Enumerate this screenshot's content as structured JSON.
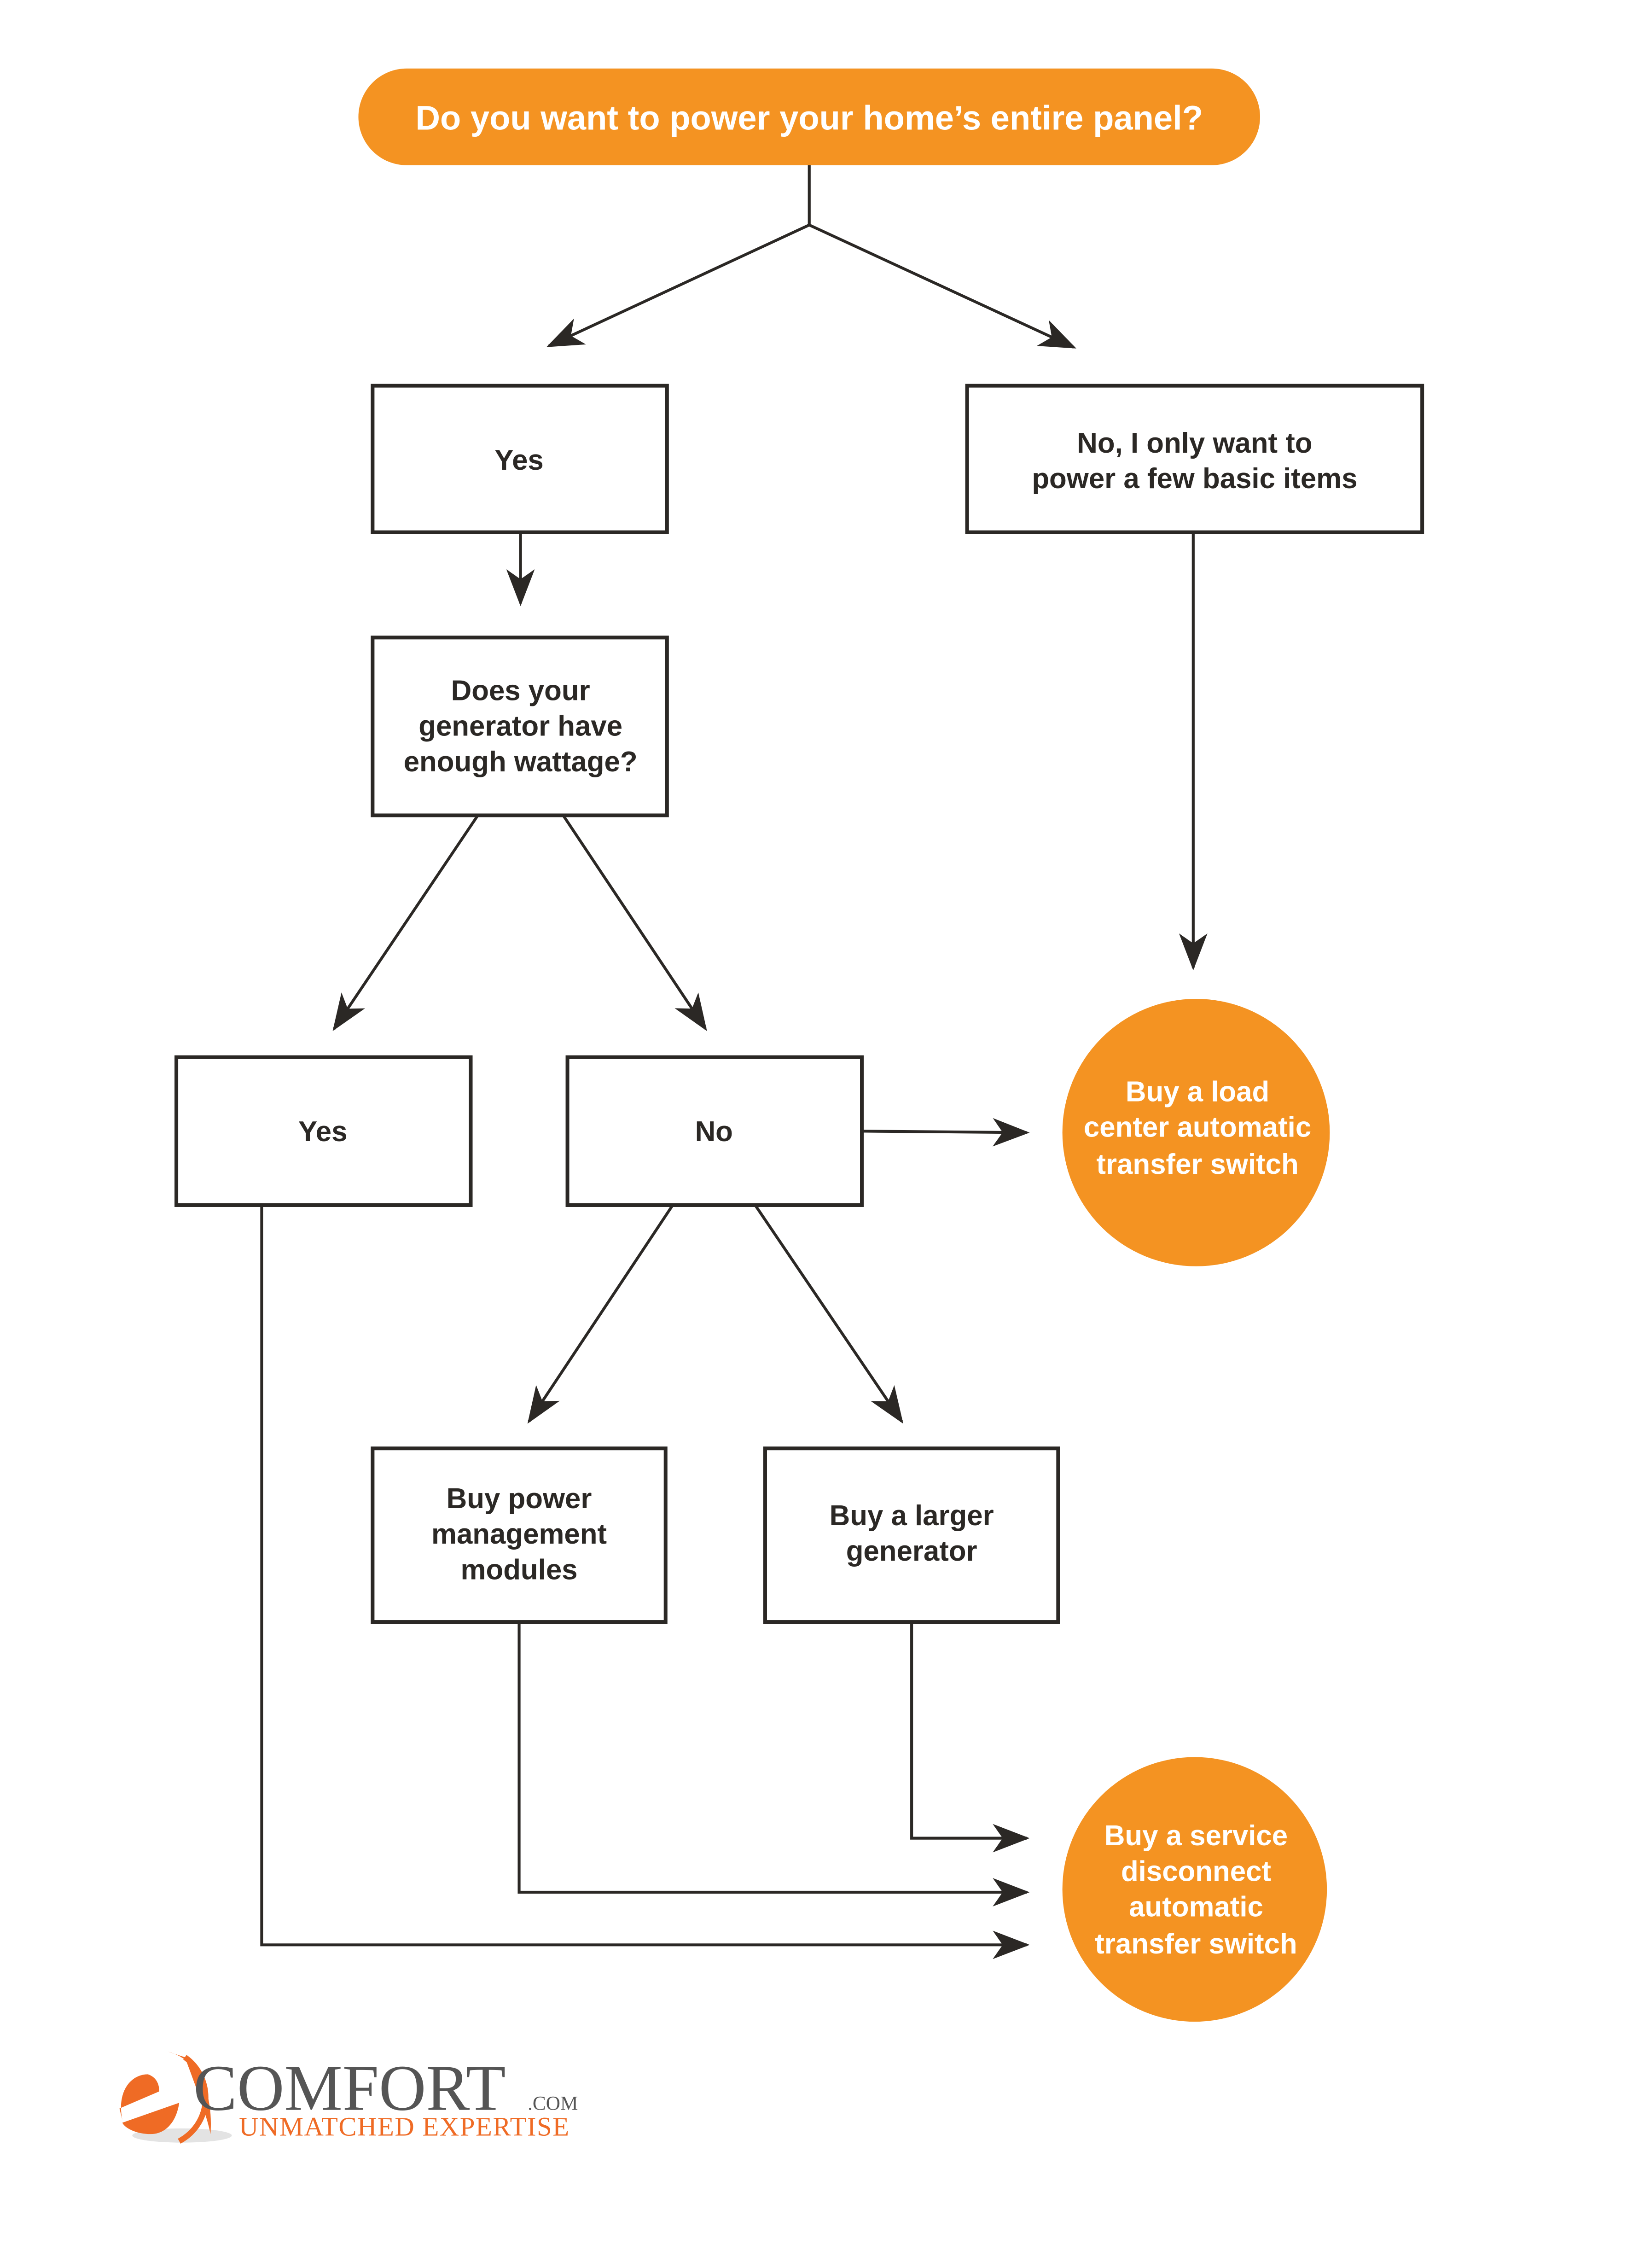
{
  "colors": {
    "accent": "#f49322",
    "stroke": "#2b2825",
    "logo_orange": "#ef6b25",
    "logo_gray": "#555555"
  },
  "title": {
    "text": "Do you want to power your home’s entire panel?"
  },
  "nodes": {
    "yes_panel": {
      "lines": [
        "Yes"
      ]
    },
    "no_basic": {
      "lines": [
        "No, I only want to",
        "power a few basic items"
      ]
    },
    "wattage_question": {
      "lines": [
        "Does your",
        "generator have",
        "enough wattage?"
      ]
    },
    "yes_wattage": {
      "lines": [
        "Yes"
      ]
    },
    "no_wattage": {
      "lines": [
        "No"
      ]
    },
    "power_modules": {
      "lines": [
        "Buy power",
        "management",
        "modules"
      ]
    },
    "larger_generator": {
      "lines": [
        "Buy a larger",
        "generator"
      ]
    },
    "load_center_ats": {
      "lines": [
        "Buy a load",
        "center automatic",
        "transfer switch"
      ]
    },
    "service_disconnect_ats": {
      "lines": [
        "Buy a service",
        "disconnect",
        "automatic",
        "transfer switch"
      ]
    }
  },
  "edges": [
    {
      "from": "title",
      "to": "yes_panel"
    },
    {
      "from": "title",
      "to": "no_basic"
    },
    {
      "from": "yes_panel",
      "to": "wattage_question"
    },
    {
      "from": "no_basic",
      "to": "load_center_ats"
    },
    {
      "from": "wattage_question",
      "to": "yes_wattage"
    },
    {
      "from": "wattage_question",
      "to": "no_wattage"
    },
    {
      "from": "no_wattage",
      "to": "load_center_ats"
    },
    {
      "from": "no_wattage",
      "to": "power_modules"
    },
    {
      "from": "no_wattage",
      "to": "larger_generator"
    },
    {
      "from": "larger_generator",
      "to": "service_disconnect_ats"
    },
    {
      "from": "power_modules",
      "to": "service_disconnect_ats"
    },
    {
      "from": "yes_wattage",
      "to": "service_disconnect_ats"
    }
  ],
  "logo": {
    "main": "COMFORT",
    "domain": ".COM",
    "tagline": "UNMATCHED EXPERTISE"
  }
}
